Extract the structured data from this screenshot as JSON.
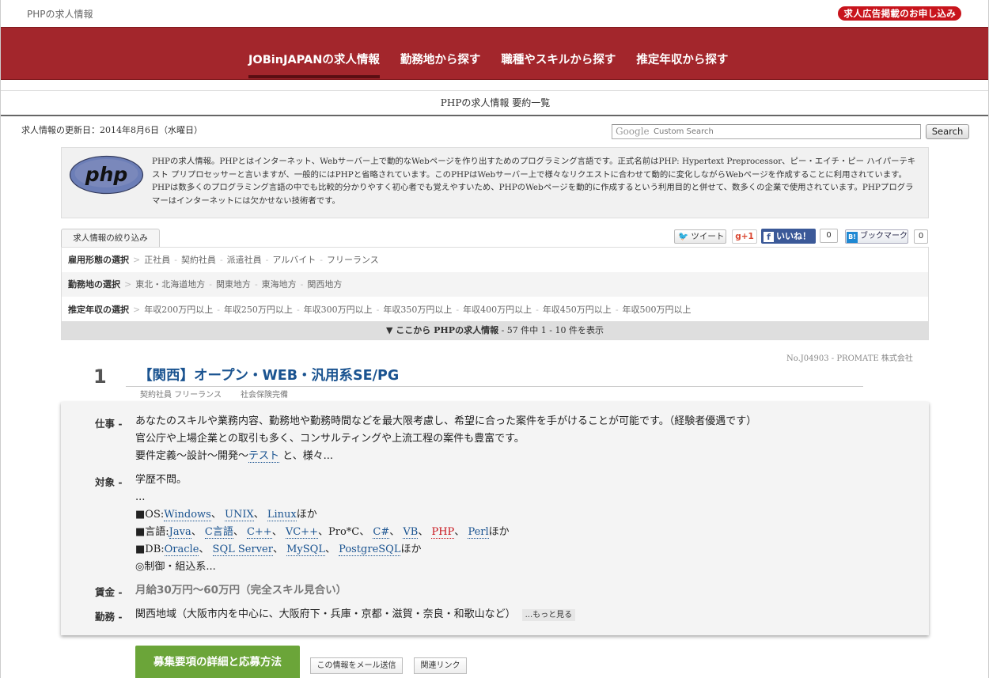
{
  "topbar": {
    "site_name": "PHPの求人情報",
    "ad_button": "求人広告掲載のお申し込み"
  },
  "nav": {
    "items": [
      {
        "label": "JOBinJAPANの求人情報",
        "active": true
      },
      {
        "label": "勤務地から探す",
        "active": false
      },
      {
        "label": "職種やスキルから探す",
        "active": false
      },
      {
        "label": "推定年収から探す",
        "active": false
      }
    ]
  },
  "page_title": "PHPの求人情報 要約一覧",
  "updated": "求人情報の更新日：2014年8月6日（水曜日）",
  "search": {
    "google_label": "Google",
    "placeholder": "Custom Search",
    "button": "Search"
  },
  "intro": {
    "logo_text": "php",
    "text": "PHPの求人情報。PHPとはインターネット、Webサーバー上で動的なWebページを作り出すためのプログラミング言語です。正式名前はPHP: Hypertext Preprocessor、ピー・エイチ・ピー ハイパーテキスト プリプロセッサーと言いますが、一般的にはPHPと省略されています。このPHPはWebサーバー上で様々なリクエストに合わせて動的に変化しながらWebページを作成することに利用されています。PHPは数多くのプログラミング言語の中でも比較的分かりやすく初心者でも覚えやすいため、PHPのWebページを動的に作成するという利用目的と併せて、数多くの企業で使用されています。PHPプログラマーはインターネットには欠かせない技術者です。"
  },
  "filter": {
    "tab_label": "求人情報の絞り込み",
    "rows": [
      {
        "label": "雇用形態の選択",
        "options": [
          "正社員",
          "契約社員",
          "派遣社員",
          "アルバイト",
          "フリーランス"
        ]
      },
      {
        "label": "勤務地の選択",
        "options": [
          "東北・北海道地方",
          "関東地方",
          "東海地方",
          "関西地方"
        ]
      },
      {
        "label": "推定年収の選択",
        "options": [
          "年収200万円以上",
          "年収250万円以上",
          "年収300万円以上",
          "年収350万円以上",
          "年収400万円以上",
          "年収450万円以上",
          "年収500万円以上"
        ]
      }
    ],
    "result_prefix": "▼ ここから PHPの求人情報",
    "result_suffix": " - 57 件中 1 - 10 件を表示"
  },
  "share": {
    "tweet": "ツイート",
    "gplus": "g+1",
    "like": "いいね！",
    "like_count": "0",
    "hatena": "ブックマーク",
    "hatena_count": "0"
  },
  "job": {
    "ref": "No.J04903 - PROMATE 株式会社",
    "number": "1",
    "title": "【関西】オープン・WEB・汎用系SE/PG",
    "tags": [
      "契約社員 フリーランス",
      "社会保険完備"
    ],
    "work_label": "仕事 -",
    "work_lines": [
      "あなたのスキルや業務内容、勤務地や勤務時間などを最大限考慮し、希望に合った案件を手がけることが可能です。（経験者優遇です）",
      "官公庁や上場企業との取引も多く、コンサルティングや上流工程の案件も豊富です。"
    ],
    "work_line3_a": "要件定義〜設計〜開発〜",
    "work_line3_link": "テスト",
    "work_line3_b": " と、様々...",
    "target_label": "対象 -",
    "target_line1": "学歴不問。",
    "target_line2": "...",
    "os_prefix": "■OS:",
    "os_links": [
      "Windows",
      "UNIX",
      "Linux"
    ],
    "os_suffix": "ほか",
    "lang_prefix": "■言語:",
    "lang_links": [
      "Java",
      "C言語",
      "C++",
      "VC++",
      "Pro*C",
      "C#",
      "VB",
      "PHP",
      "Perl"
    ],
    "lang_suffix": "ほか",
    "db_prefix": "■DB:",
    "db_links": [
      "Oracle",
      "SQL Server",
      "MySQL",
      "PostgreSQL"
    ],
    "db_suffix": "ほか",
    "target_last": "◎制御・組込系...",
    "salary_label": "賃金 -",
    "salary": "月給30万円〜60万円（完全スキル見合い）",
    "location_label": "勤務 -",
    "location": "関西地域（大阪市内を中心に、大阪府下・兵庫・京都・滋賀・奈良・和歌山など）",
    "more": "...もっと見る",
    "apply_button": "募集要項の詳細と応募方法",
    "mail_button": "この情報をメール送信",
    "related_button": "関連リンク"
  },
  "colors": {
    "nav_bg": "#a3262c",
    "accent_red": "#c8141c",
    "link_blue": "#1a5390",
    "apply_green": "#6ba539"
  }
}
